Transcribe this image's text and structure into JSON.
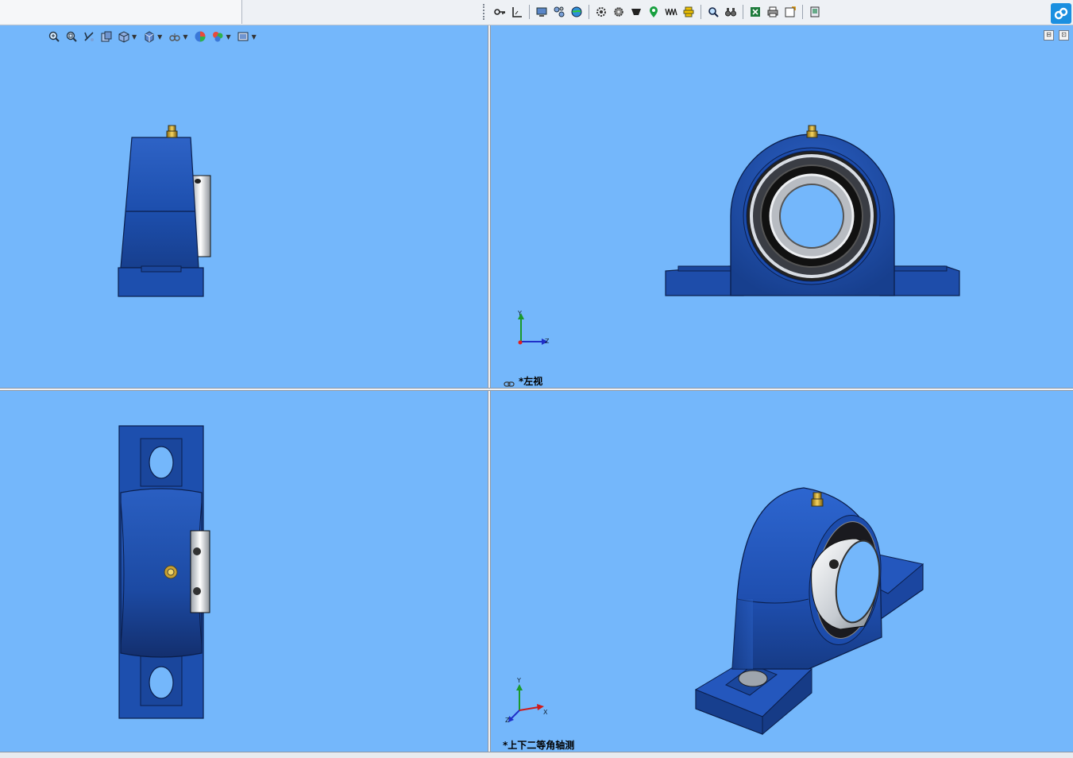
{
  "toolbar": {
    "icons": [
      "key-icon",
      "measure-icon",
      "display-icon",
      "assembly-icon",
      "globe-icon",
      "settings-icon",
      "gear-icon",
      "hopper-icon",
      "map-pin-icon",
      "spring-icon",
      "bolt-icon",
      "zoom-search-icon",
      "binoculars-icon",
      "excel-icon",
      "print-icon",
      "export-icon",
      "help-book-icon"
    ]
  },
  "hud": {
    "icons": [
      "zoom-to-fit-icon",
      "zoom-area-icon",
      "previous-view-icon",
      "section-view-icon",
      "view-orientation-icon",
      "display-style-icon",
      "hide-show-icon",
      "appearance-icon",
      "scene-icon",
      "view-settings-icon"
    ]
  },
  "viewports": {
    "top_right": {
      "label": "*左视",
      "axis": {
        "y": "Y",
        "z": "Z"
      }
    },
    "bottom_right": {
      "label": "*上下二等角轴测",
      "axis": {
        "y": "Y",
        "x": "X",
        "z": "Z"
      }
    }
  },
  "colors": {
    "viewport_bg": "#74b7fb",
    "housing_blue": "#1f4fb0",
    "brand_blue": "#1a8fe0"
  }
}
